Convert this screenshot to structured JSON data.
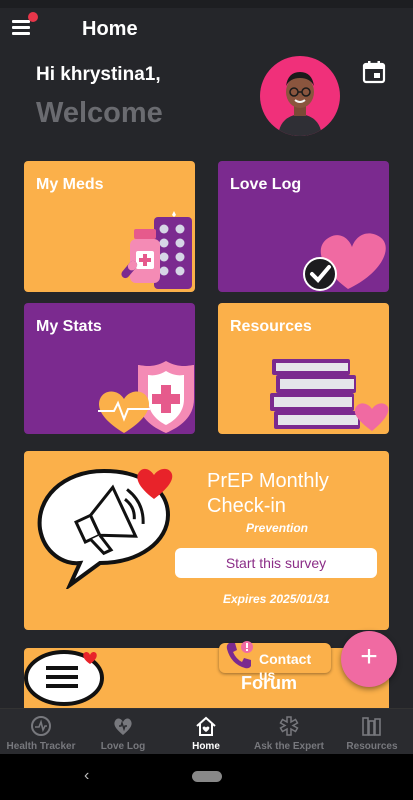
{
  "header": {
    "title": "Home",
    "menu_icon": "hamburger-menu-icon",
    "notification_dot_color": "#e8364a"
  },
  "greeting": {
    "hello": "Hi khrystina1,",
    "welcome": "Welcome"
  },
  "tiles": [
    {
      "title": "My Meds",
      "color": "#fbb04a",
      "icon": "medicine-bottle-icon"
    },
    {
      "title": "Love Log",
      "color": "#7b2a8f",
      "icon": "heart-check-icon"
    },
    {
      "title": "My Stats",
      "color": "#7b2a8f",
      "icon": "health-shield-icon"
    },
    {
      "title": "Resources",
      "color": "#fbb04a",
      "icon": "books-icon"
    }
  ],
  "survey": {
    "title": "PrEP Monthly Check-in",
    "subtitle": "Prevention",
    "button": "Start this survey",
    "expires": "Expires 2025/01/31"
  },
  "forum": {
    "title": "Forum"
  },
  "contact": {
    "label": "Contact us"
  },
  "fab": {
    "label": "+"
  },
  "bottom_nav": [
    {
      "label": "Health Tracker",
      "icon": "health-tracker-icon",
      "active": false
    },
    {
      "label": "Love Log",
      "icon": "love-log-heart-icon",
      "active": false
    },
    {
      "label": "Home",
      "icon": "home-heart-icon",
      "active": true
    },
    {
      "label": "Ask the Expert",
      "icon": "medical-caduceus-icon",
      "active": false
    },
    {
      "label": "Resources",
      "icon": "resources-books-icon",
      "active": false
    }
  ],
  "colors": {
    "background": "#25262a",
    "orange": "#fbb04a",
    "purple": "#7b2a8f",
    "pink": "#f06aa2",
    "avatar_bg": "#f0307a"
  }
}
